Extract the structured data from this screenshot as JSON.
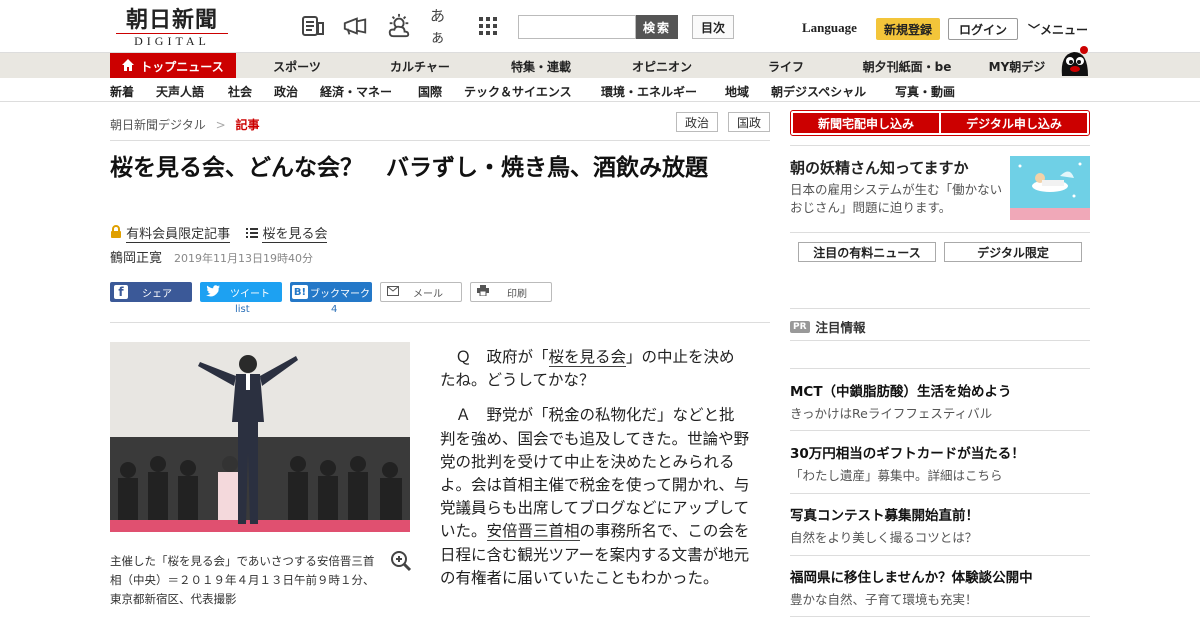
{
  "header": {
    "logo_jp": "朝日新聞",
    "logo_en": "DIGITAL",
    "icons": [
      "newspaper-icon",
      "megaphone-icon",
      "weather-icon",
      "font-size-icon",
      "grid-icon"
    ],
    "font_label": "あぁ",
    "search_button": "検索",
    "mokuji": "目次",
    "language": "Language",
    "register": "新規登録",
    "login": "ログイン",
    "menu": "メニュー"
  },
  "nav1": [
    "トップニュース",
    "スポーツ",
    "カルチャー",
    "特集・連載",
    "オピニオン",
    "ライフ",
    "朝夕刊紙面・be",
    "MY朝デジ"
  ],
  "nav2": [
    "新着",
    "天声人語",
    "社会",
    "政治",
    "経済・マネー",
    "国際",
    "テック＆サイエンス",
    "環境・エネルギー",
    "地域",
    "朝デジスペシャル",
    "写真・動画"
  ],
  "breadcrumb": {
    "home": "朝日新聞デジタル",
    "sep": ">",
    "current": "記事"
  },
  "tags": [
    "政治",
    "国政"
  ],
  "article": {
    "title": "桜を見る会、どんな会？　バラずし・焼き鳥、酒飲み放題",
    "paid_label": "有料会員限定記事",
    "series_label": "桜を見る会",
    "author": "鶴岡正寛",
    "date": "2019年11月13日19時40分",
    "share": {
      "facebook": "シェア",
      "twitter": "ツイート",
      "hatena": "ブックマーク",
      "mail": "メール",
      "print": "印刷"
    },
    "twitter_count": "list",
    "hatena_count": "4",
    "caption": "主催した「桜を見る会」であいさつする安倍晋三首相（中央）＝２０１９年４月１３日午前９時１分、東京都新宿区、代表撮影",
    "p1_a": "Ｑ　政府が「",
    "p1_link": "桜を見る会",
    "p1_b": "」の中止を決めたね。どうしてかな？",
    "p2_a": "Ａ　野党が「税金の私物化だ」などと批判を強め、国会でも追及してきた。世論や野党の批判を受けて中止を決めたとみられるよ。会は首相主催で税金を使って開かれ、与党議員らも出席してブログなどにアップしていた。",
    "p2_link": "安倍晋三首相",
    "p2_b": "の事務所名で、この会を日程に含む観光ツアーを案内する文書が地元の有権者に届いていたこともわかった。"
  },
  "sidebar": {
    "btn_delivery": "新聞宅配申し込み",
    "btn_digital": "デジタル申し込み",
    "promo_title": "朝の妖精さん知ってますか",
    "promo_desc": "日本の雇用システムが生む「働かないおじさん」問題に迫ります。",
    "btn_news": "注目の有料ニュース",
    "btn_limited": "デジタル限定",
    "pr_badge": "PR",
    "pr_label": "注目情報",
    "ads": [
      {
        "title": "MCT（中鎖脂肪酸）生活を始めよう",
        "desc": "きっかけはReライフフェスティバル"
      },
      {
        "title": "30万円相当のギフトカードが当たる！",
        "desc": "「わたし遺産」募集中。詳細はこちら"
      },
      {
        "title": "写真コンテスト募集開始直前！",
        "desc": "自然をより美しく撮るコツとは？"
      },
      {
        "title": "福岡県に移住しませんか？体験談公開中",
        "desc": "豊かな自然、子育て環境も充実！"
      }
    ]
  },
  "colors": {
    "accent": "#cc0000",
    "nav_bg": "#e9e7e1",
    "register": "#f3c53a"
  }
}
